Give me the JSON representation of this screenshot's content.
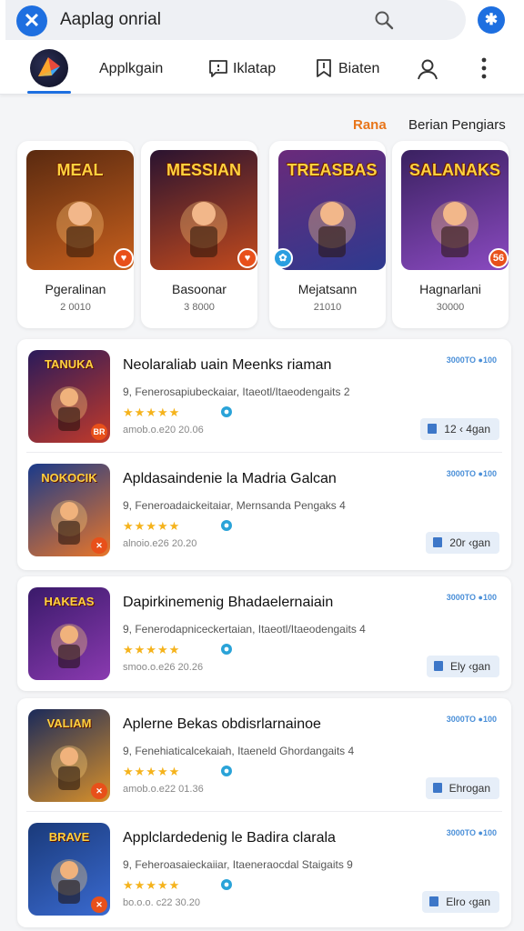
{
  "search": {
    "text": "Aaplag onrial",
    "close_label": "✕",
    "action_label": "✱"
  },
  "nav": {
    "tabs": [
      {
        "label": "Applkgain"
      },
      {
        "label": "Iklatap"
      },
      {
        "label": "Biaten"
      }
    ]
  },
  "sort": {
    "active": "Rana",
    "other": "Berian Pengiars"
  },
  "featured": [
    {
      "thumb_title": "MEAL",
      "name": "Pgeralinan",
      "count": "2 0010",
      "badge": "♥",
      "badge_color": "#e8501a",
      "bg": [
        "#5a2a10",
        "#c8601d"
      ]
    },
    {
      "thumb_title": "MESSIAN",
      "name": "Basoonar",
      "count": "3 8000",
      "badge": "♥",
      "badge_color": "#e8501a",
      "bg": [
        "#2a1330",
        "#c24a1d"
      ]
    },
    {
      "thumb_title": "TREASBAS",
      "name": "Mejatsann",
      "count": "21010",
      "badge": "✿",
      "badge_color": "#2a9ee0",
      "bg": [
        "#6a2a7a",
        "#2e3a8f"
      ]
    },
    {
      "thumb_title": "SALANAKS",
      "name": "Hagnarlani",
      "count": "30000",
      "badge": "56",
      "badge_color": "#e8501a",
      "bg": [
        "#3a2160",
        "#8a4ac0"
      ]
    }
  ],
  "list": [
    {
      "thumb_title": "TANUKA",
      "title": "Neolaraliab uain Meenks riaman",
      "desc": "9, Fenerosapiubeckaiar, Itaeotl/Itaeodengaits 2",
      "stars": "★★★★★",
      "meta": "amob.o.e20 20.06",
      "tag": "3000TO ●100",
      "button": "12 ‹ 4gan",
      "badge": "BR"
    },
    {
      "thumb_title": "NOKOCIK",
      "title": "Apldasaindenie la Madria Galcan",
      "desc": "9, Feneroadaickeitaiar, Mernsanda Pengaks 4",
      "stars": "★★★★★",
      "meta": "alnoio.e26 20.20",
      "tag": "3000TO ●100",
      "button": "20r ‹gan",
      "badge": "✕"
    },
    {
      "thumb_title": "HAKEAS",
      "title": "Dapirkinemenig Bhadaelernaiain",
      "desc": "9, Fenerodapniceckertaian, Itaeotl/Itaeodengaits 4",
      "stars": "★★★★★",
      "meta": "smoo.o.e26 20.26",
      "tag": "3000TO ●100",
      "button": "Ely ‹gan",
      "badge": ""
    },
    {
      "thumb_title": "VALIAM",
      "title": "Aplerne Bekas obdisrlarnainoe",
      "desc": "9, Fenehiaticalcekaiah, Itaeneld Ghordangaits 4",
      "stars": "★★★★★",
      "meta": "amob.o.e22 01.36",
      "tag": "3000TO ●100",
      "button": "Ehrogan",
      "badge": "✕"
    },
    {
      "thumb_title": "BRAVE",
      "title": "Applclardedenig le Badira clarala",
      "desc": "9, Feheroasaieckaiiar, Itaeneraocdal Staigaits 9",
      "stars": "★★★★★",
      "meta": "bo.o.o. c22 30.20",
      "tag": "3000TO ●100",
      "button": "Elro ‹gan",
      "badge": "✕"
    }
  ],
  "colors": {
    "accent": "#1e6fe0",
    "highlight": "#e8751a",
    "star": "#f5b31c"
  },
  "icons": [
    "close-icon",
    "search-icon",
    "app-logo",
    "chat-icon",
    "bookmark-icon",
    "person-icon",
    "more-icon",
    "heart-icon",
    "thumb-up-icon"
  ]
}
